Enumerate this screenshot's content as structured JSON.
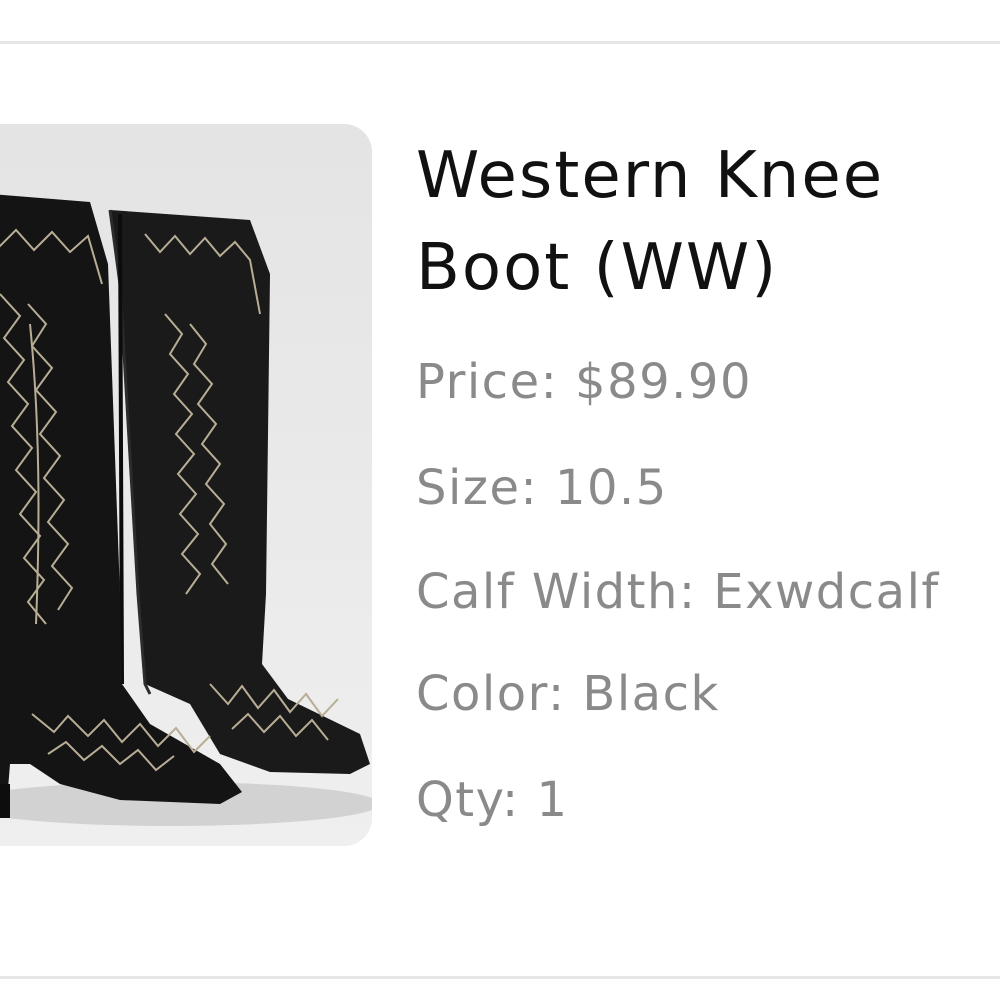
{
  "product": {
    "title": "Western Knee Boot (WW)",
    "image_alt": "Black western knee boots with stitched embroidery",
    "price": "Price: $89.90",
    "size": "Size: 10.5",
    "calf_width": "Calf Width: Exwdcalf",
    "color": "Color: Black",
    "qty": "Qty: 1"
  },
  "colors": {
    "title": "#111111",
    "attribute_text": "#8a8a8a",
    "divider": "#e6e6e6",
    "image_background": "#e9e9e9",
    "boot": "#161616",
    "stitching": "#b8ad95"
  }
}
